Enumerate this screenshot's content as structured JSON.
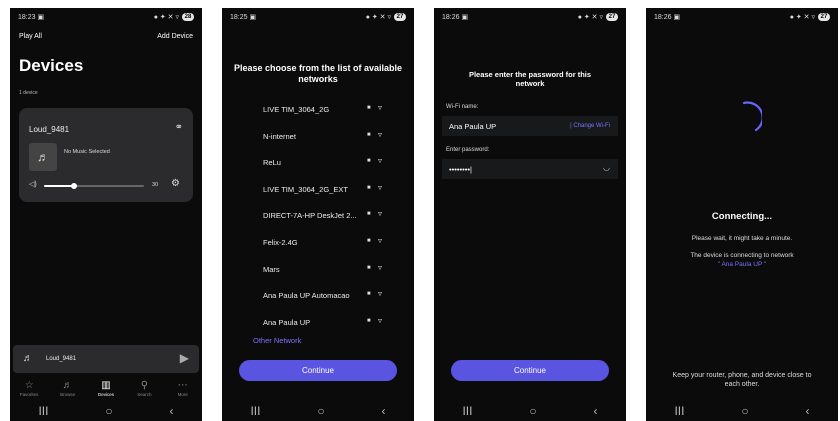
{
  "icons": {
    "status_left": "▣",
    "status_right": "● ✦ ✕ ▿",
    "nav": [
      "III",
      "○",
      "‹"
    ],
    "link": "⚭",
    "music": "♬",
    "volume": "◁)",
    "gear": "⚙",
    "play": "▶",
    "lock": "■",
    "wifi": "▿",
    "eye": "◡"
  },
  "accent_color": "#5a55e0",
  "screen1": {
    "status_time": "18:23",
    "battery": "28",
    "play_all": "Play All",
    "add_device": "Add Device",
    "title": "Devices",
    "device_count": "1 device",
    "device": {
      "name": "Loud_9481",
      "track": "No Music Selected",
      "volume_value": "30",
      "volume_fraction": 0.3
    },
    "mini_player_name": "Loud_9481",
    "tabs": [
      {
        "icon": "☆",
        "label": "Favorites"
      },
      {
        "icon": "♬",
        "label": "Browse"
      },
      {
        "icon": "▥",
        "label": "Devices"
      },
      {
        "icon": "⚲",
        "label": "Search"
      },
      {
        "icon": "⋯",
        "label": "More"
      }
    ]
  },
  "screen2": {
    "status_time": "18:25",
    "battery": "27",
    "heading": "Please choose from the list of available networks",
    "networks": [
      "LIVE TIM_3064_2G",
      "N-internet",
      "ReLu",
      "LIVE TIM_3064_2G_EXT",
      "DIRECT-7A-HP DeskJet 2...",
      "Felix-2.4G",
      "Mars",
      "Ana Paula UP Automacao",
      "Ana Paula UP"
    ],
    "other_network": "Other Network",
    "continue": "Continue"
  },
  "screen3": {
    "status_time": "18:26",
    "battery": "27",
    "heading": "Please enter the password for this network",
    "wifi_label": "Wi-Fi name:",
    "wifi_value": "Ana Paula UP",
    "change_wifi": "| Change Wi-Fi",
    "password_label": "Enter password:",
    "password_value": "••••••••|",
    "continue": "Continue"
  },
  "screen4": {
    "status_time": "18:26",
    "battery": "27",
    "connecting": "Connecting...",
    "wait": "Please wait, it might take a minute.",
    "device_connecting": "The device is connecting to network",
    "network_name": "\" Ana Paula UP \"",
    "keep_close": "Keep your router, phone, and device close to each other."
  }
}
